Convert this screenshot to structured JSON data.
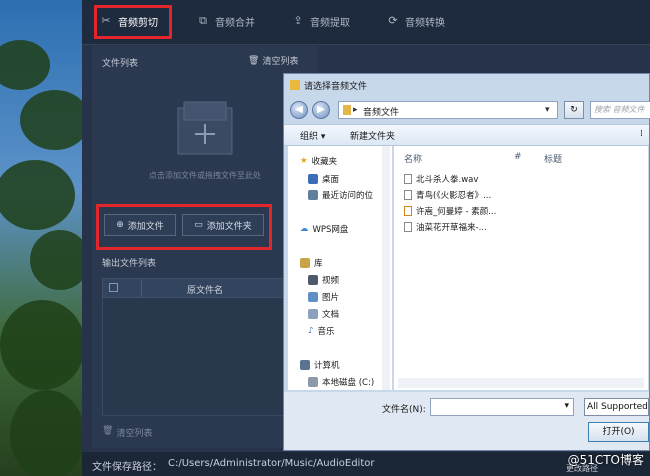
{
  "app": {
    "tabs": [
      {
        "label": "音频剪切",
        "icon": "scissors-icon",
        "active": true
      },
      {
        "label": "音频合并",
        "icon": "merge-icon",
        "active": false
      },
      {
        "label": "音频提取",
        "icon": "upload-icon",
        "active": false
      },
      {
        "label": "音频转换",
        "icon": "convert-icon",
        "active": false
      }
    ],
    "left_panel": {
      "file_list_title": "文件列表",
      "clear_list_label": "清空列表",
      "drop_hint": "点击添加文件或拖拽文件至此处",
      "add_file_label": "添加文件",
      "add_folder_label": "添加文件夹",
      "output_list_title": "输出文件列表",
      "grid_column": "原文件名",
      "clear_bottom_label": "清空列表"
    },
    "status": {
      "save_path_label": "文件保存路径：",
      "save_path": "C:/Users/Administrator/Music/AudioEditor",
      "change_path_label": "更改路径"
    },
    "highlight_color": "#e3262c"
  },
  "dialog": {
    "title": "请选择音频文件",
    "address": "音频文件",
    "search_placeholder": "搜索 音频文件",
    "toolbar": {
      "organize": "组织",
      "new_folder": "新建文件夹"
    },
    "nav": {
      "favorites": "收藏夹",
      "desktop": "桌面",
      "recent": "最近访问的位",
      "wps": "WPS网盘",
      "library": "库",
      "video": "视频",
      "pictures": "图片",
      "documents": "文档",
      "music": "音乐",
      "computer": "计算机",
      "local_disk": "本地磁盘 (C:)"
    },
    "columns": {
      "name": "名称",
      "number": "#",
      "title": "标题"
    },
    "files": [
      "北斗杀人拳.wav",
      "青鸟(《火影忍者》...",
      "许嵩_何曼婷 - 素颜...",
      "油菜花开草福来-..."
    ],
    "filename_label": "文件名(N):",
    "filename_value": "",
    "filetype_value": "All Supported",
    "open_label": "打开(O)"
  },
  "watermark": "@51CTO博客"
}
